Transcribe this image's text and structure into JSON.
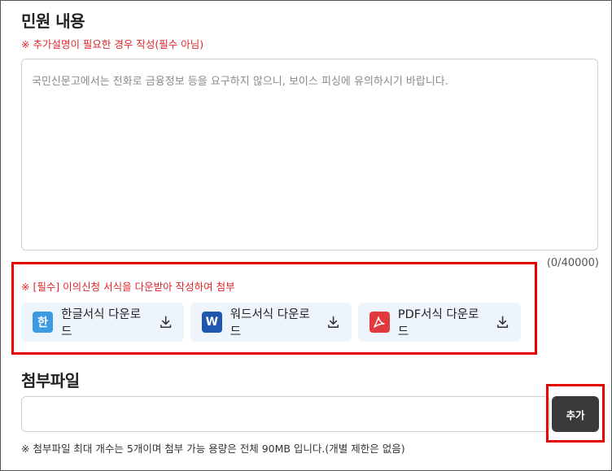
{
  "complaint": {
    "title": "민원 내용",
    "notice": "※ 추가설명이 필요한 경우 작성(필수 아님)",
    "placeholder": "국민신문고에서는 전화로 금융정보 등을 요구하지 않으니, 보이스 피싱에 유의하시기 바랍니다.",
    "counter": "(0/40000)"
  },
  "forms": {
    "required_note": "※ [필수] 이의신청 서식을 다운받아 작성하여 첨부",
    "buttons": [
      {
        "icon": "hwp-icon",
        "icon_text": "한",
        "label": "한글서식 다운로드",
        "color": "#3b9ae1"
      },
      {
        "icon": "word-icon",
        "icon_text": "W",
        "label": "워드서식 다운로드",
        "color": "#1f56b0"
      },
      {
        "icon": "pdf-icon",
        "icon_text": "",
        "label": "PDF서식 다운로드",
        "color": "#e0393e"
      }
    ]
  },
  "attachment": {
    "title": "첨부파일",
    "add_label": "추가",
    "note": "※ 첨부파일 최대 개수는 5개이며 첨부 가능 용량은 전체 90MB 입니다.(개별 제한은 없음)"
  }
}
